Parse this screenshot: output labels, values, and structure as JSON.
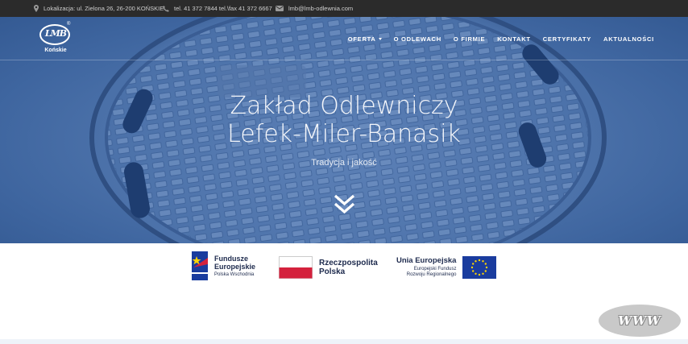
{
  "topbar": {
    "location": "Lokalizacja: ul. Zielona 26, 26-200 KOŃSKIE",
    "phone": "tel. 41 372 7844 tel.\\fax 41 372 6667",
    "email": "lmb@lmb-odlewnia.com",
    "icons": [
      "map-marker-icon",
      "phone-icon",
      "envelope-icon"
    ]
  },
  "logo": {
    "mark": "LMB",
    "city": "Końskie",
    "reg": "®"
  },
  "nav": {
    "items": [
      {
        "label": "OFERTA",
        "dropdown": true
      },
      {
        "label": "O ODLEWACH"
      },
      {
        "label": "O FIRMIE"
      },
      {
        "label": "KONTAKT"
      },
      {
        "label": "CERTYFIKATY"
      },
      {
        "label": "AKTUALNOŚCI"
      }
    ]
  },
  "hero": {
    "title_line1": "Zakład Odlewniczy",
    "title_line2": "Lefek-Miler-Banasik",
    "tagline": "Tradycja i jakość"
  },
  "funding": {
    "fe_title_1": "Fundusze",
    "fe_title_2": "Europejskie",
    "fe_sub": "Polska Wschodnia",
    "rp_line1": "Rzeczpospolita",
    "rp_line2": "Polska",
    "ue_title": "Unia Europejska",
    "ue_sub1": "Europejski Fundusz",
    "ue_sub2": "Rozwoju Regionalnego"
  },
  "badge": {
    "label": "WWW"
  },
  "colors": {
    "topbar": "#2b2b2b",
    "hero_blue": "#4c72aa",
    "eu_blue": "#1a3c9e",
    "eu_star": "#ffd400",
    "pl_red": "#d4213d"
  }
}
